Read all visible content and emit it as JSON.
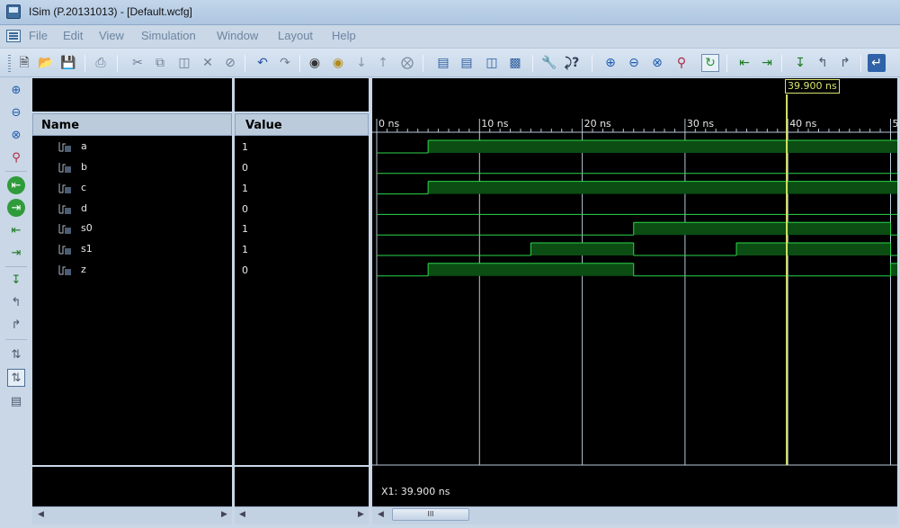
{
  "window": {
    "title": "ISim (P.20131013) - [Default.wcfg]"
  },
  "menu": {
    "items": [
      "File",
      "Edit",
      "View",
      "Simulation",
      "Window",
      "Layout",
      "Help"
    ]
  },
  "toolbar": {
    "icons": [
      "new-file-icon",
      "open-folder-icon",
      "save-icon",
      "print-icon",
      "cut-icon",
      "copy-icon",
      "paste-icon",
      "delete-icon",
      "stop-icon",
      "undo-icon",
      "redo-icon",
      "find-icon",
      "find-next-icon",
      "down-arrow-icon",
      "up-arrow-icon",
      "clear-icon",
      "cascade-icon",
      "tile-horizontal-icon",
      "tile-vertical-icon",
      "float-icon",
      "wrench-icon",
      "help-cursor-icon",
      "zoom-in-icon",
      "zoom-out-icon",
      "zoom-fit-icon",
      "zoom-cursor-icon",
      "refresh-icon",
      "prev-transition-icon",
      "next-transition-icon",
      "add-marker-icon",
      "prev-marker-icon",
      "next-marker-icon",
      "swap-icon"
    ]
  },
  "left_toolbar": {
    "icons": [
      "zoom-in-icon",
      "zoom-out-icon",
      "zoom-fit-icon",
      "zoom-cursor-icon",
      "go-start-icon",
      "go-end-icon",
      "prev-transition-icon",
      "next-transition-icon",
      "add-marker-icon",
      "prev-marker-icon",
      "next-marker-icon",
      "swap-icon",
      "floating-ruler-icon",
      "console-icon"
    ]
  },
  "name_panel": {
    "header": "Name"
  },
  "value_panel": {
    "header": "Value"
  },
  "signals": [
    {
      "name": "a",
      "value": "1"
    },
    {
      "name": "b",
      "value": "0"
    },
    {
      "name": "c",
      "value": "1"
    },
    {
      "name": "d",
      "value": "0"
    },
    {
      "name": "s0",
      "value": "1"
    },
    {
      "name": "s1",
      "value": "1"
    },
    {
      "name": "z",
      "value": "0"
    }
  ],
  "waveform": {
    "time_unit": "ns",
    "tick_labels": [
      "0 ns",
      "10 ns",
      "20 ns",
      "30 ns",
      "40 ns",
      "5"
    ],
    "time_range_ns": [
      0,
      50.5
    ],
    "traces": [
      {
        "name": "a",
        "transitions_ns": [
          0,
          5
        ],
        "levels": [
          0,
          1
        ]
      },
      {
        "name": "b",
        "transitions_ns": [
          0
        ],
        "levels": [
          0
        ]
      },
      {
        "name": "c",
        "transitions_ns": [
          0,
          5
        ],
        "levels": [
          0,
          1
        ]
      },
      {
        "name": "d",
        "transitions_ns": [
          0
        ],
        "levels": [
          0
        ]
      },
      {
        "name": "s0",
        "transitions_ns": [
          0,
          25,
          50
        ],
        "levels": [
          0,
          1,
          0
        ]
      },
      {
        "name": "s1",
        "transitions_ns": [
          0,
          15,
          25,
          35,
          50
        ],
        "levels": [
          0,
          1,
          0,
          1,
          0
        ]
      },
      {
        "name": "z",
        "transitions_ns": [
          0,
          5,
          25,
          50
        ],
        "levels": [
          0,
          1,
          0,
          1
        ]
      }
    ],
    "cursor_ns": 39.9,
    "cursor_label": "39.900 ns",
    "x1_readout": "X1: 39.900 ns",
    "colors": {
      "high_fill": "#0b4d13",
      "line": "#2bd64a",
      "cursor": "#d9e36a",
      "grid": "#b7c7d8"
    }
  },
  "scrollbar": {
    "thumb_grip": "III"
  }
}
